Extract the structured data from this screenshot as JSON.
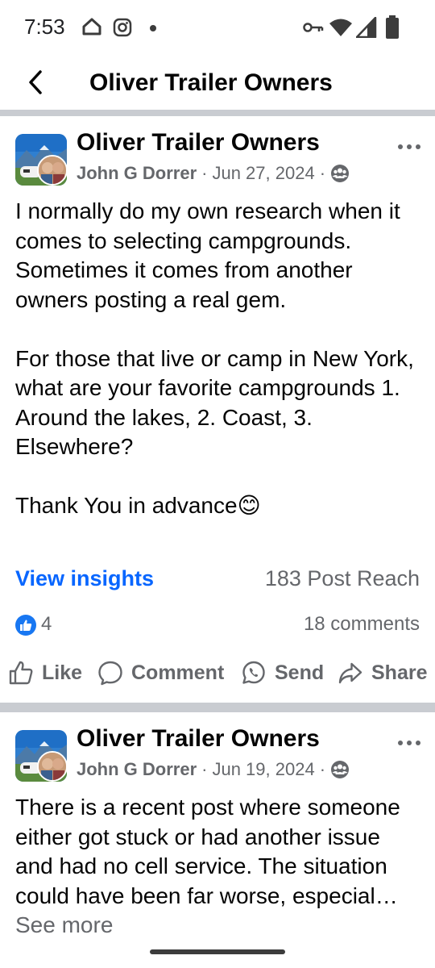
{
  "status_bar": {
    "time": "7:53",
    "icons": [
      "home-icon",
      "instagram-icon",
      "notification-dot",
      "vpn-key-icon",
      "wifi-icon",
      "signal-icon",
      "battery-icon"
    ]
  },
  "header": {
    "back_icon": "chevron-left-icon",
    "title": "Oliver Trailer Owners"
  },
  "posts": [
    {
      "group_name": "Oliver Trailer Owners",
      "author": "John G Dorrer",
      "separator": "·",
      "date": "Jun 27, 2024",
      "audience_icon": "group-members-icon",
      "paragraphs": [
        "I normally do my own research when it comes to selecting campgrounds. Sometimes it comes from another owners posting a real gem.",
        "For those that live or camp in New York, what are your favorite campgrounds 1. Around the lakes, 2. Coast, 3. Elsewhere?",
        "Thank You in advance😊"
      ],
      "view_insights": "View insights",
      "post_reach": "183 Post Reach",
      "like_count": "4",
      "comment_count": "18 comments",
      "actions": [
        "Like",
        "Comment",
        "Send",
        "Share"
      ]
    },
    {
      "group_name": "Oliver Trailer Owners",
      "author": "John G Dorrer",
      "separator": "·",
      "date": "Jun 19, 2024",
      "audience_icon": "group-members-icon",
      "text": "There is a recent post where someone either got stuck or had another issue and had no cell service. The situation could have been far worse, especial…",
      "see_more": " See more"
    }
  ],
  "colors": {
    "accent": "#0866ff",
    "like_blue": "#1877f2",
    "secondary_text": "#65676b",
    "divider": "#c9ccd1"
  }
}
